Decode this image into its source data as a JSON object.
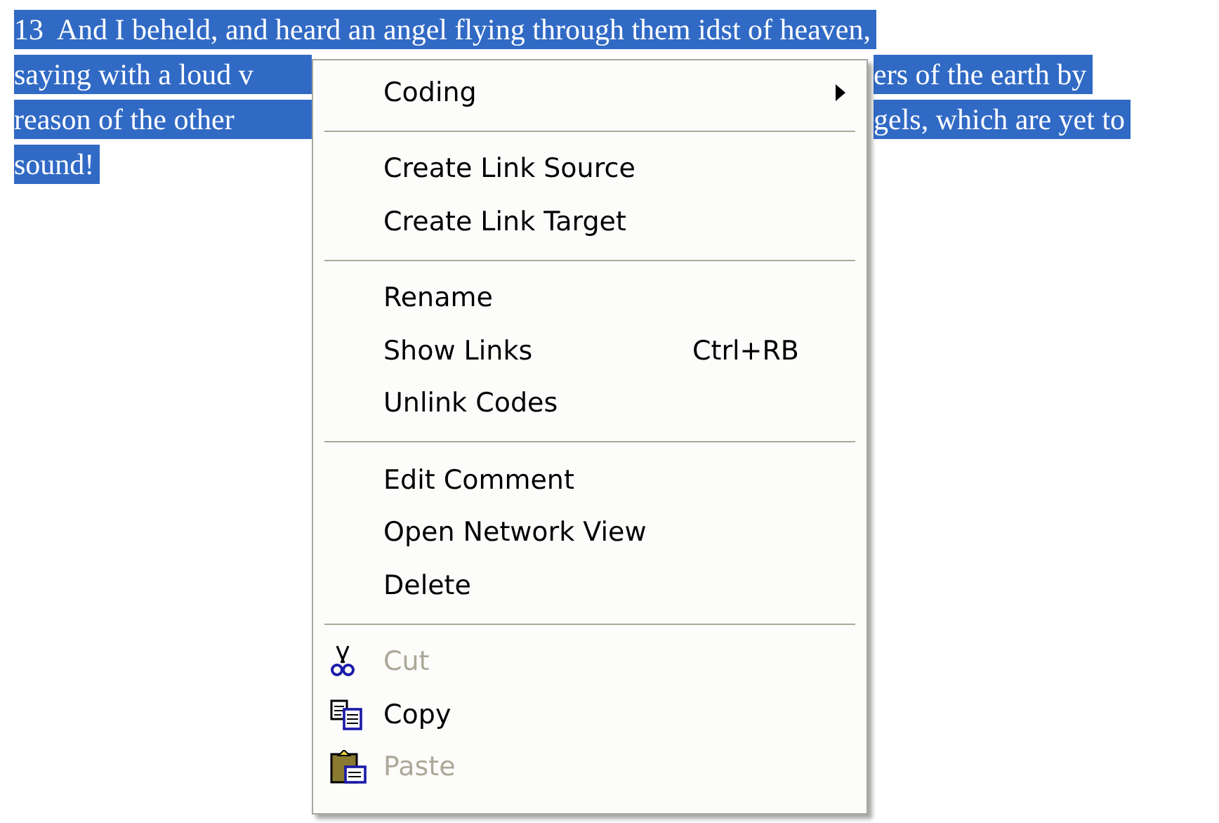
{
  "document": {
    "lines": [
      {
        "left": "13  And I beheld, and heard an angel flying through them idst of heaven,"
      },
      {
        "left": "saying with a loud v",
        "right": "ers of the earth by"
      },
      {
        "left": "reason of the other",
        "right": "gels, which are yet to"
      },
      {
        "left": "sound!"
      }
    ]
  },
  "context_menu": {
    "sections": [
      {
        "items": [
          {
            "label": "Coding",
            "kind": "submenu",
            "disabled": false
          }
        ]
      },
      {
        "items": [
          {
            "label": "Create Link Source",
            "kind": "text",
            "disabled": false
          },
          {
            "label": "Create Link Target",
            "kind": "text",
            "disabled": false
          }
        ]
      },
      {
        "items": [
          {
            "label": "Rename",
            "kind": "text",
            "disabled": false
          },
          {
            "label": "Show Links",
            "kind": "text",
            "shortcut": "Ctrl+RB",
            "disabled": false
          },
          {
            "label": "Unlink Codes",
            "kind": "text",
            "disabled": false
          }
        ]
      },
      {
        "items": [
          {
            "label": "Edit Comment",
            "kind": "text",
            "disabled": false
          },
          {
            "label": "Open Network View",
            "kind": "text",
            "disabled": false
          },
          {
            "label": "Delete",
            "kind": "text",
            "disabled": false
          }
        ]
      },
      {
        "items": [
          {
            "label": "Cut",
            "kind": "cut",
            "disabled": true
          },
          {
            "label": "Copy",
            "kind": "copy",
            "disabled": false
          },
          {
            "label": "Paste",
            "kind": "paste",
            "disabled": true
          }
        ]
      }
    ]
  }
}
